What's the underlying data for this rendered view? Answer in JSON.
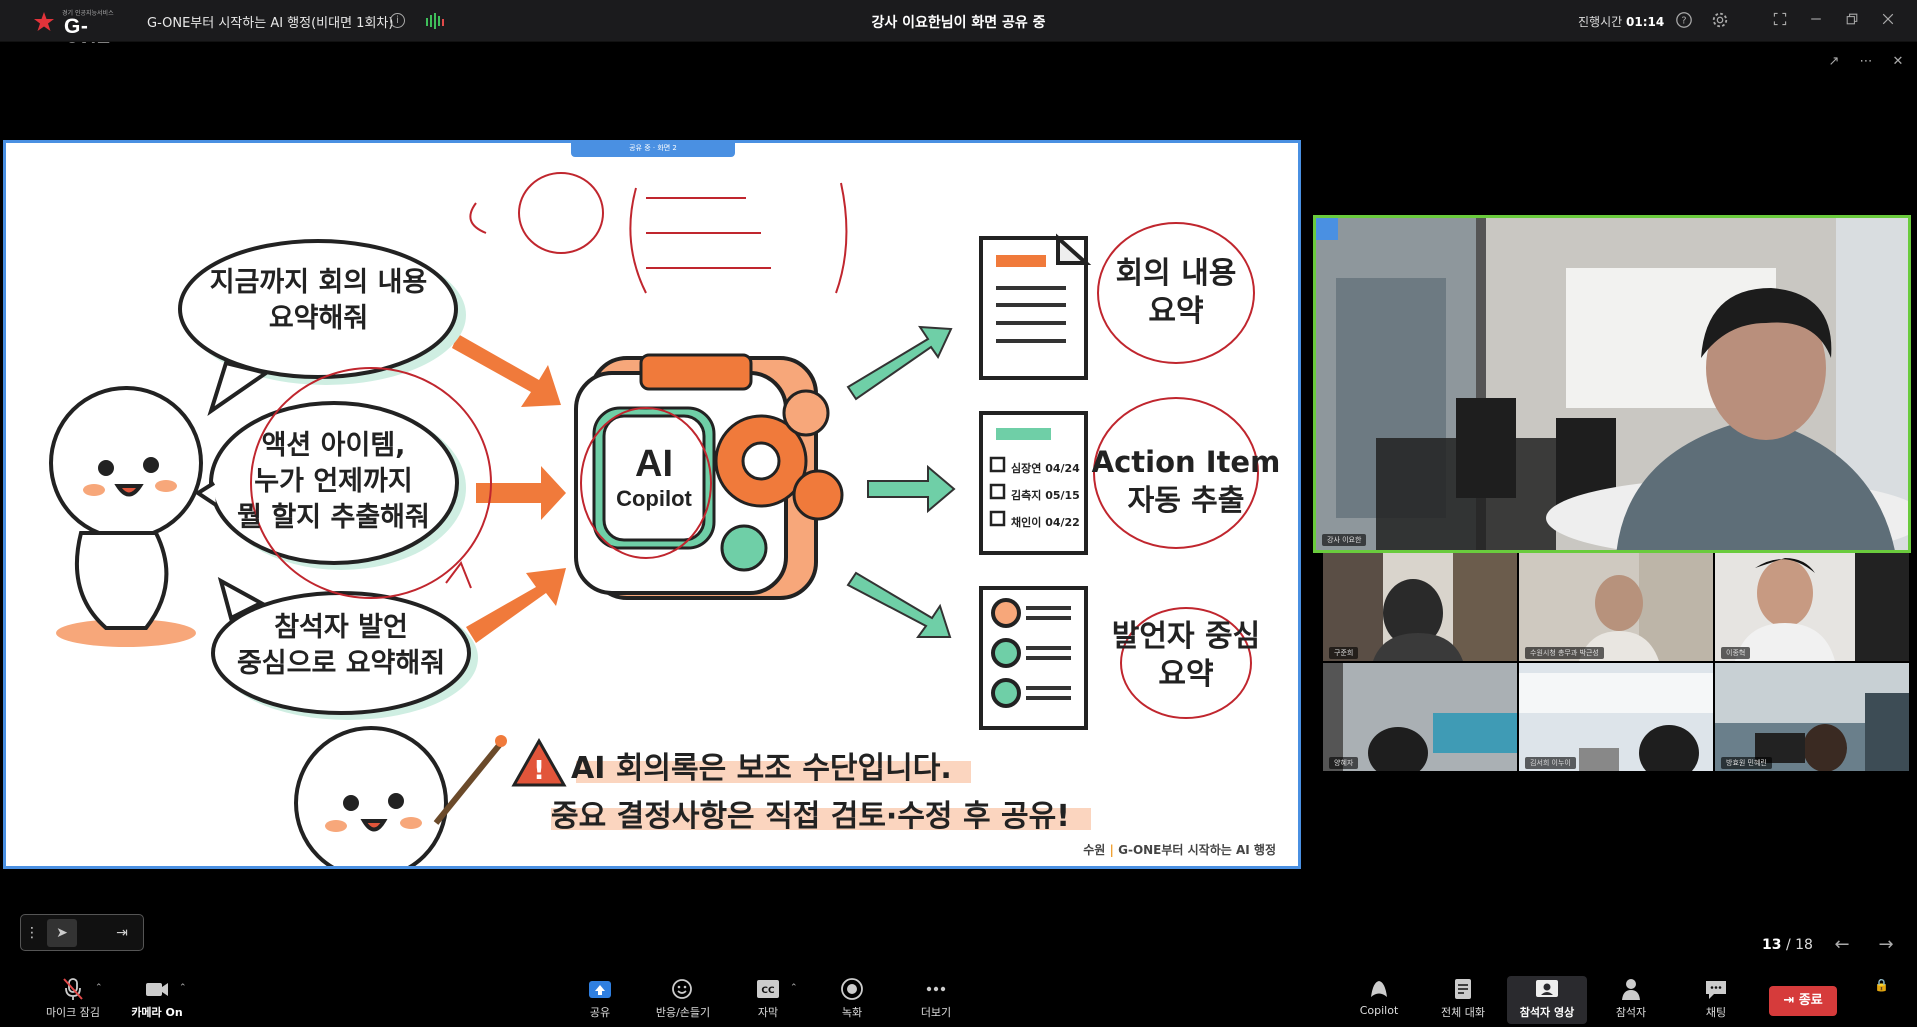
{
  "titlebar": {
    "logo_small": "경기 인공지능서비스",
    "logo_text": "G-ONE",
    "meeting_title": "G-ONE부터 시작하는 AI 행정(비대면 1회차)",
    "share_status": "강사 이요한님이 화면 공유 중",
    "elapsed_label": "진행시간",
    "elapsed_value": "01:14"
  },
  "share": {
    "tab_label": "공유 중 · 화면 2"
  },
  "slide": {
    "bubble1": [
      "지금까지 회의 내용",
      "요약해줘"
    ],
    "bubble2": [
      "액션 아이템,",
      "누가 언제까지",
      "뭘 할지 추출해줘"
    ],
    "bubble3": [
      "참석자 발언",
      "중심으로 요약해줘"
    ],
    "center_line1": "AI",
    "center_line2": "Copilot",
    "checklist": [
      "심장연 04/24",
      "김측지 05/15",
      "채인이 04/22"
    ],
    "result1": [
      "회의 내용",
      "요약"
    ],
    "result2": [
      "Action Item",
      "자동 추출"
    ],
    "result3": [
      "발언자 중심",
      "요약"
    ],
    "warning1": "AI 회의록은 보조 수단입니다.",
    "warning2": "중요 결정사항은 직접 검토·수정 후 공유!",
    "footer_left": "수원",
    "footer_right": "G-ONE부터 시작하는 AI 행정"
  },
  "videos": {
    "main_name": "강사 이요한",
    "tiles": [
      "구준희",
      "수원시청 총무과 박근성",
      "이종혁",
      "양혜자",
      "김서희 이누이",
      "방효원 민혜린"
    ]
  },
  "pager": {
    "current": "13",
    "total": "/ 18"
  },
  "toolbar": {
    "mic": "마이크 잠김",
    "camera": "카메라 On",
    "share": "공유",
    "reaction": "반응/손들기",
    "caption": "자막",
    "record": "녹화",
    "more": "더보기",
    "copilot": "Copilot",
    "all_chat": "전체 대화",
    "participant_video": "참석자 영상",
    "participants": "참석자",
    "chat": "채팅",
    "end": "종료"
  },
  "colors": {
    "accent_blue": "#4a90e2",
    "speaker_green": "#6acb3d",
    "end_red": "#d63b3b",
    "slide_orange": "#f07a3b",
    "slide_mint": "#6fcfa7"
  }
}
